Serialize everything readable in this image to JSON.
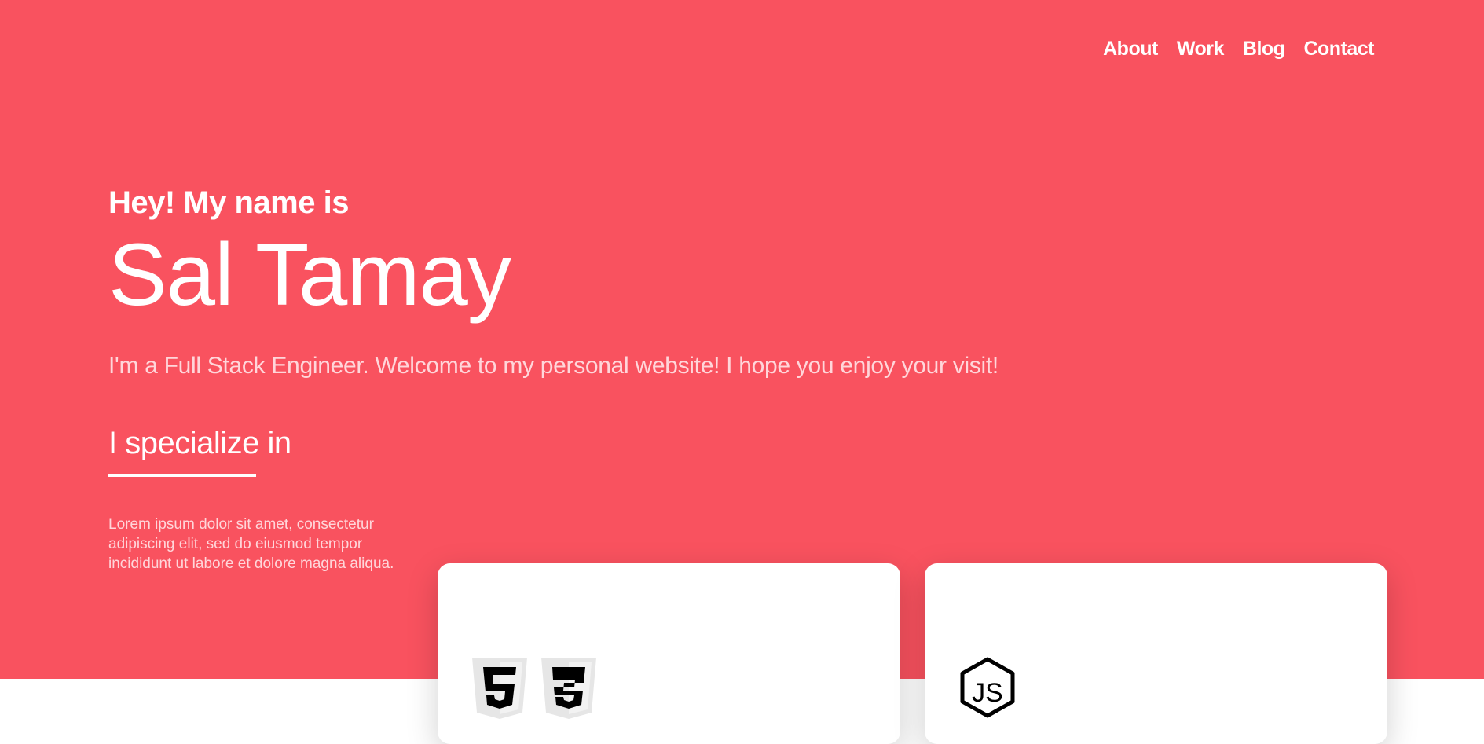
{
  "nav": {
    "items": [
      "About",
      "Work",
      "Blog",
      "Contact"
    ]
  },
  "hero": {
    "greeting": "Hey! My name is",
    "name": "Sal Tamay",
    "tagline": "I'm a Full Stack Engineer. Welcome to my personal website! I hope you enjoy your visit!",
    "specialize_heading": "I specialize in",
    "description": "Lorem ipsum dolor sit amet, consectetur adipiscing elit, sed do eiusmod tempor incididunt ut labore et dolore magna aliqua."
  },
  "cards": [
    {
      "icons": [
        "html5-icon",
        "css3-icon"
      ]
    },
    {
      "icons": [
        "nodejs-icon"
      ]
    }
  ],
  "colors": {
    "hero_bg": "#f9525f",
    "text": "#ffffff",
    "muted_text": "#ffd6da",
    "card_bg": "#ffffff"
  }
}
